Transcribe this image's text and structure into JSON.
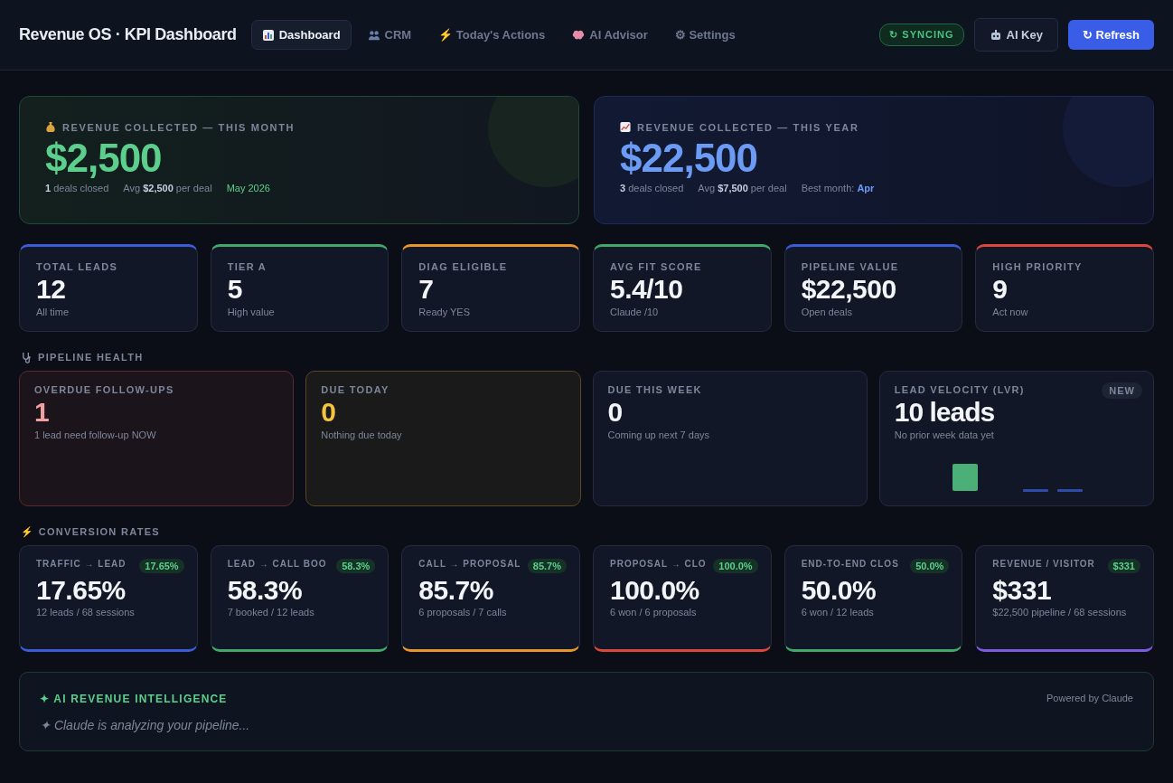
{
  "header": {
    "title": "Revenue OS · KPI Dashboard",
    "tabs": [
      {
        "label": "Dashboard",
        "kind": "chart",
        "selected": true
      },
      {
        "label": "CRM",
        "kind": "people",
        "selected": false
      },
      {
        "label": "⚡ Today's Actions",
        "kind": "text",
        "selected": false
      },
      {
        "label": "AI Advisor",
        "kind": "brain",
        "selected": false
      },
      {
        "label": "⚙ Settings",
        "kind": "text",
        "selected": false
      }
    ],
    "status": "↻ SYNCING",
    "ai_key": "AI Key",
    "refresh": "↻ Refresh"
  },
  "revenue": [
    {
      "kind": "month",
      "label": "REVENUE COLLECTED — THIS MONTH",
      "value": "$2,500",
      "meta": [
        {
          "text": "**1** deals closed",
          "kind": "plain"
        },
        {
          "text": "Avg **$2,500** per deal",
          "kind": "plain"
        },
        {
          "text": "May 2026",
          "kind": "accent"
        }
      ]
    },
    {
      "kind": "year",
      "label": "REVENUE COLLECTED — THIS YEAR",
      "value": "$22,500",
      "meta": [
        {
          "text": "**3** deals closed",
          "kind": "plain"
        },
        {
          "text": "Avg **$7,500** per deal",
          "kind": "plain"
        },
        {
          "text": "Best month: **Apr**",
          "kind": "highlight"
        }
      ]
    }
  ],
  "kpis": [
    {
      "label": "TOTAL LEADS",
      "value": "12",
      "sub": "All time",
      "color": "#3b5bdb"
    },
    {
      "label": "TIER A",
      "value": "5",
      "sub": "High value",
      "color": "#40a96a"
    },
    {
      "label": "DIAG ELIGIBLE",
      "value": "7",
      "sub": "Ready YES",
      "color": "#e8952a"
    },
    {
      "label": "AVG FIT SCORE",
      "value": "5.4/10",
      "sub": "Claude /10",
      "color": "#40a96a"
    },
    {
      "label": "PIPELINE VALUE",
      "value": "$22,500",
      "sub": "Open deals",
      "color": "#3b5bdb"
    },
    {
      "label": "HIGH PRIORITY",
      "value": "9",
      "sub": "Act now",
      "color": "#d9473d"
    }
  ],
  "pipeline_health": {
    "title": "PIPELINE HEALTH",
    "cards": [
      {
        "kind": "danger",
        "label": "OVERDUE FOLLOW-UPS",
        "value": "1",
        "sub": "1 lead need follow-up NOW"
      },
      {
        "kind": "warning",
        "label": "DUE TODAY",
        "value": "0",
        "sub": "Nothing due today"
      },
      {
        "kind": "neutral",
        "label": "DUE THIS WEEK",
        "value": "0",
        "sub": "Coming up next 7 days"
      },
      {
        "kind": "velocity",
        "label": "LEAD VELOCITY (LVR)",
        "value": "10 leads",
        "sub": "No prior week data yet",
        "badge": "NEW"
      }
    ]
  },
  "conversion_rates": {
    "title": "⚡ CONVERSION RATES",
    "cards": [
      {
        "label": "TRAFFIC → LEAD",
        "badge": "17.65%",
        "value": "17.65%",
        "sub": "12 leads / 68 sessions",
        "color": "#3b5bdb"
      },
      {
        "label": "LEAD → CALL BOO",
        "badge": "58.3%",
        "value": "58.3%",
        "sub": "7 booked / 12 leads",
        "color": "#40a96a"
      },
      {
        "label": "CALL → PROPOSAL",
        "badge": "85.7%",
        "value": "85.7%",
        "sub": "6 proposals / 7 calls",
        "color": "#e8952a"
      },
      {
        "label": "PROPOSAL → CLO",
        "badge": "100.0%",
        "value": "100.0%",
        "sub": "6 won / 6 proposals",
        "color": "#d9473d"
      },
      {
        "label": "END-TO-END CLOS",
        "badge": "50.0%",
        "value": "50.0%",
        "sub": "6 won / 12 leads",
        "color": "#40a96a"
      },
      {
        "label": "REVENUE / VISITOR",
        "badge": "$331",
        "value": "$331",
        "sub": "$22,500 pipeline / 68 sessions",
        "color": "#7b5ce0"
      }
    ]
  },
  "ai_panel": {
    "title": "✦ AI REVENUE INTELLIGENCE",
    "powered": "Powered by Claude",
    "status": "✦ Claude is analyzing your pipeline..."
  }
}
